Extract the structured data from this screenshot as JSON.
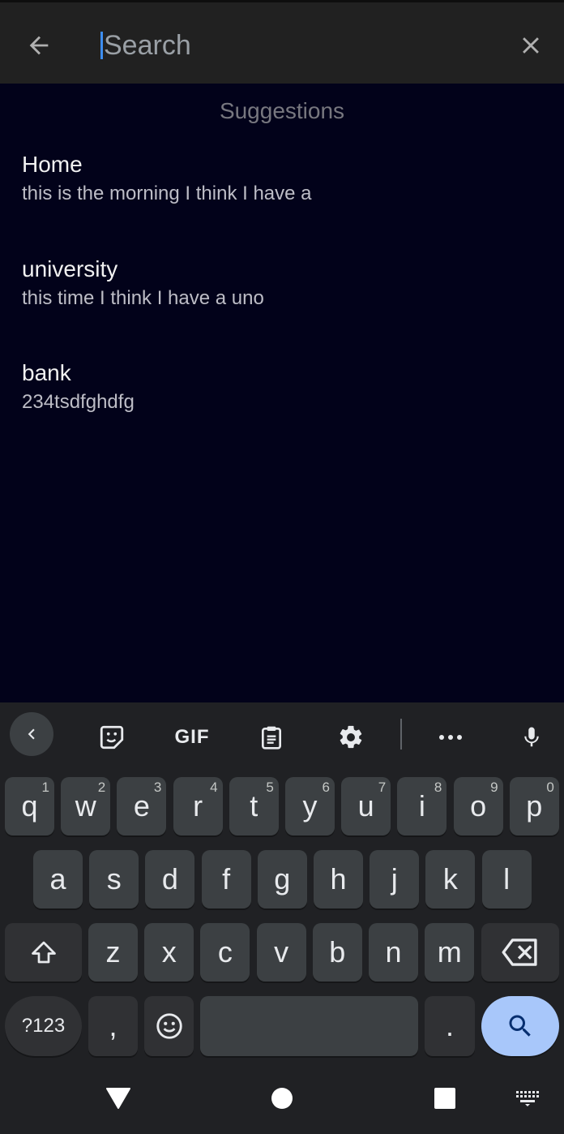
{
  "search": {
    "placeholder": "Search",
    "value": ""
  },
  "suggestions": {
    "header": "Suggestions",
    "items": [
      {
        "title": "Home",
        "subtitle": "this is the morning I think I have a"
      },
      {
        "title": "university",
        "subtitle": "this time I think I have a uno"
      },
      {
        "title": "bank",
        "subtitle": "234tsdfghdfg"
      }
    ]
  },
  "keyboard": {
    "gif_label": "GIF",
    "row1": [
      {
        "key": "q",
        "hint": "1"
      },
      {
        "key": "w",
        "hint": "2"
      },
      {
        "key": "e",
        "hint": "3"
      },
      {
        "key": "r",
        "hint": "4"
      },
      {
        "key": "t",
        "hint": "5"
      },
      {
        "key": "y",
        "hint": "6"
      },
      {
        "key": "u",
        "hint": "7"
      },
      {
        "key": "i",
        "hint": "8"
      },
      {
        "key": "o",
        "hint": "9"
      },
      {
        "key": "p",
        "hint": "0"
      }
    ],
    "row2": [
      "a",
      "s",
      "d",
      "f",
      "g",
      "h",
      "j",
      "k",
      "l"
    ],
    "row3": [
      "z",
      "x",
      "c",
      "v",
      "b",
      "n",
      "m"
    ],
    "symbols_label": "?123",
    "comma_label": ",",
    "period_label": "."
  },
  "colors": {
    "accent": "#3d8ef0",
    "search_key": "#a8c7fa",
    "background": "#02021a"
  }
}
